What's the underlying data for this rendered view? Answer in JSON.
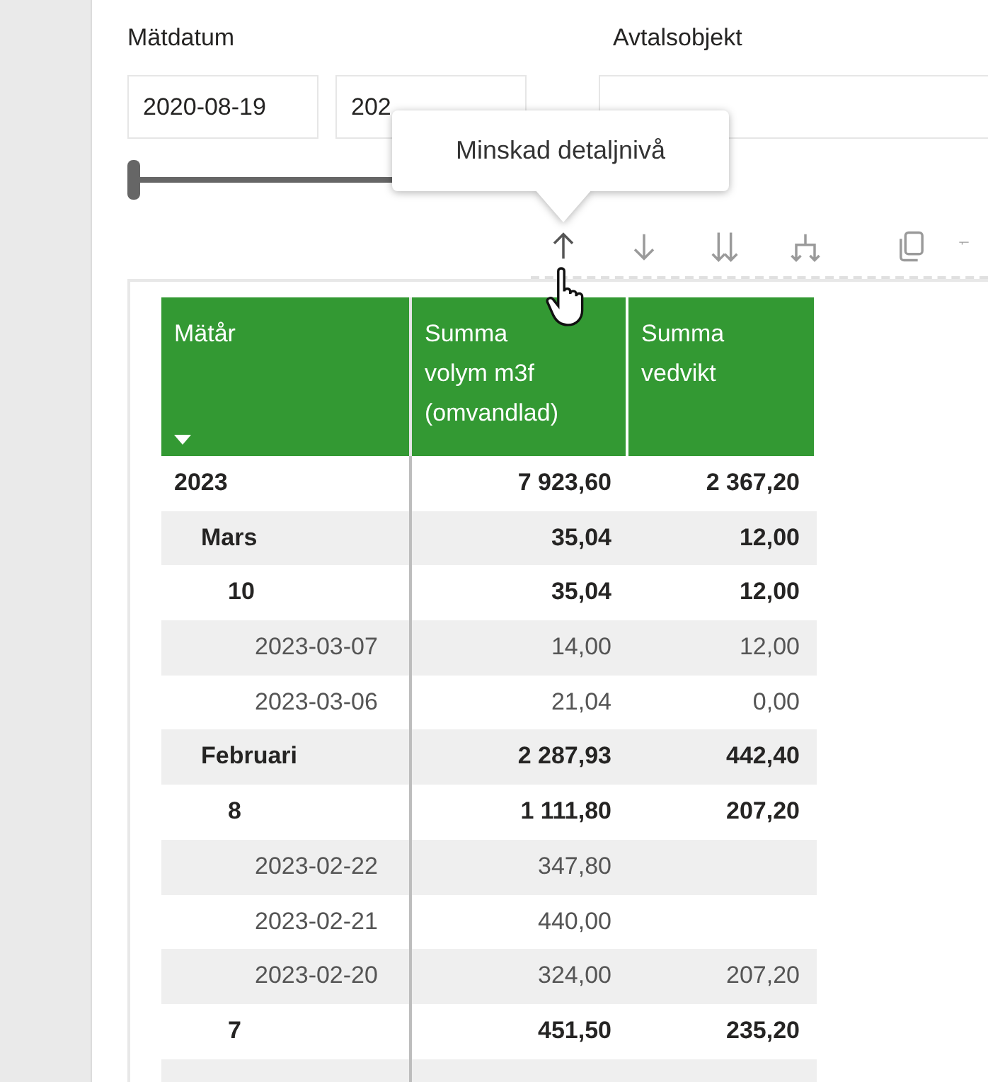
{
  "filters": {
    "date": {
      "label": "Mätdatum",
      "from": "2020-08-19",
      "to": "202",
      "slider": {
        "level": 0
      }
    },
    "object": {
      "label": "Avtalsobjekt"
    }
  },
  "tooltip": "Minskad detaljnivå",
  "toolbar": [
    {
      "kind": "drill-up"
    },
    {
      "kind": "drill-down"
    },
    {
      "kind": "next-level"
    },
    {
      "kind": "expand"
    },
    {
      "kind": "copy"
    },
    {
      "kind": "filter"
    }
  ],
  "table": {
    "columns": [
      {
        "label": "Mätår",
        "sorted": true
      },
      {
        "label": "Summa volym m3f (omvandlad)",
        "sorted": false
      },
      {
        "label": "Summa vedvikt",
        "sorted": false
      }
    ],
    "rows": [
      {
        "label": "2023",
        "volym": "7 923,60",
        "vedvikt": "2 367,20",
        "children": [
          {
            "label": "Mars",
            "volym": "35,04",
            "vedvikt": "12,00",
            "children": [
              {
                "label": "10",
                "volym": "35,04",
                "vedvikt": "12,00",
                "children": [
                  {
                    "label": "2023-03-07",
                    "volym": "14,00",
                    "vedvikt": "12,00"
                  },
                  {
                    "label": "2023-03-06",
                    "volym": "21,04",
                    "vedvikt": "0,00"
                  }
                ]
              }
            ]
          },
          {
            "label": "Februari",
            "volym": "2 287,93",
            "vedvikt": "442,40",
            "children": [
              {
                "label": "8",
                "volym": "1 111,80",
                "vedvikt": "207,20",
                "children": [
                  {
                    "label": "2023-02-22",
                    "volym": "347,80"
                  },
                  {
                    "label": "2023-02-21",
                    "volym": "440,00"
                  },
                  {
                    "label": "2023-02-20",
                    "volym": "324,00",
                    "vedvikt": "207,20"
                  }
                ]
              },
              {
                "label": "7",
                "volym": "451,50",
                "vedvikt": "235,20"
              }
            ]
          }
        ]
      }
    ]
  }
}
